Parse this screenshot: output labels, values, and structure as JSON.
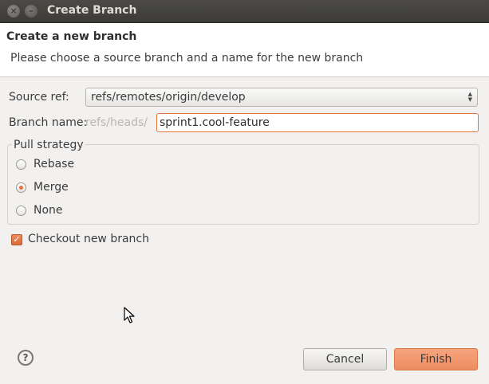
{
  "window": {
    "title": "Create Branch",
    "close_glyph": "×",
    "minimize_glyph": "–"
  },
  "banner": {
    "title": "Create a new branch",
    "description": "Please choose a source branch and a name for the new branch"
  },
  "form": {
    "source_ref_label": "Source ref:",
    "source_ref_value": "refs/remotes/origin/develop",
    "branch_name_label": "Branch name:",
    "branch_prefix": "refs/heads/",
    "branch_name_value": "sprint1.cool-feature"
  },
  "pull_strategy": {
    "legend": "Pull strategy",
    "options": [
      {
        "label": "Rebase",
        "selected": false
      },
      {
        "label": "Merge",
        "selected": true
      },
      {
        "label": "None",
        "selected": false
      }
    ]
  },
  "checkout": {
    "label": "Checkout new branch",
    "checked": true,
    "check_glyph": "✓"
  },
  "buttons": {
    "help_glyph": "?",
    "cancel": "Cancel",
    "finish": "Finish"
  },
  "colors": {
    "accent": "#e3733f",
    "finish_button": "#f09a72",
    "titlebar": "#3c3b37"
  }
}
